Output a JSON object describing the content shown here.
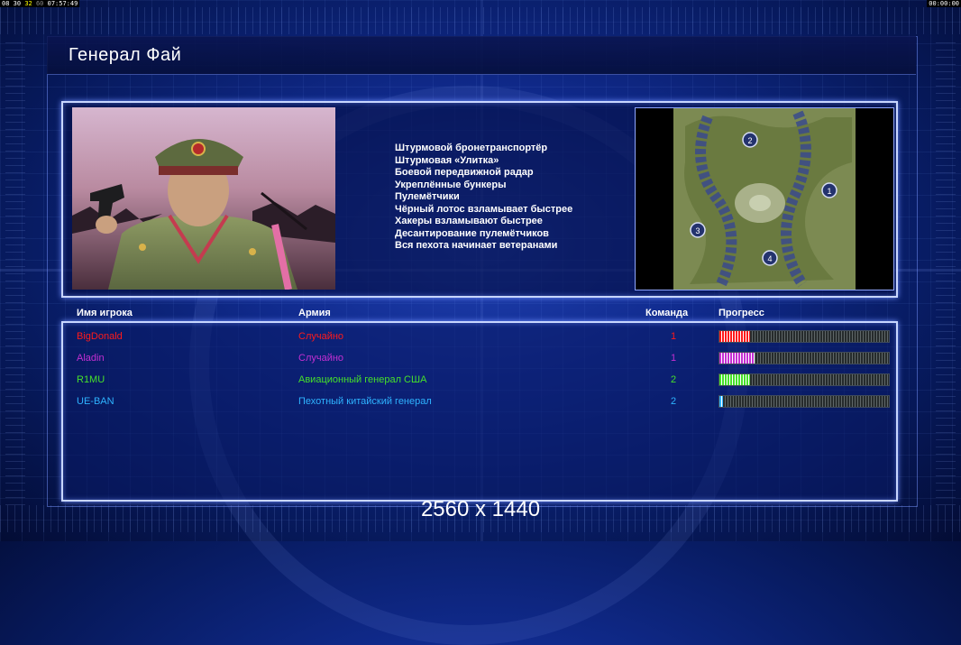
{
  "hud": {
    "left_parts": [
      "08",
      "30",
      "32",
      "60",
      "07:57:49"
    ],
    "right": "00:00:00"
  },
  "title": "Генерал Фай",
  "features": [
    "Штурмовой бронетранспортёр",
    "Штурмовая «Улитка»",
    "Боевой передвижной радар",
    "Укреплённые бункеры",
    "Пулемётчики",
    "Чёрный лотос взламывает быстрее",
    "Хакеры взламывают быстрее",
    "Десантирование пулемётчиков",
    "Вся пехота начинает ветеранами"
  ],
  "map": {
    "markers": [
      "1",
      "2",
      "3",
      "4"
    ]
  },
  "table": {
    "headers": {
      "player": "Имя игрока",
      "army": "Армия",
      "team": "Команда",
      "progress": "Прогресс"
    },
    "rows": [
      {
        "name": "BigDonald",
        "army": "Случайно",
        "team": "1",
        "color": "#ff1a1a",
        "progress": 0.18
      },
      {
        "name": "Aladin",
        "army": "Случайно",
        "team": "1",
        "color": "#c42fd2",
        "progress": 0.21
      },
      {
        "name": "R1MU",
        "army": "Авиационный генерал США",
        "team": "2",
        "color": "#46e02a",
        "progress": 0.18
      },
      {
        "name": "UE-BAN",
        "army": "Пехотный китайский генерал",
        "team": "2",
        "color": "#2eb3ff",
        "progress": 0.02
      }
    ]
  },
  "resolution": "2560 x 1440",
  "colors": {
    "panel_border": "#c8d6ff",
    "background": "#102a8c"
  }
}
